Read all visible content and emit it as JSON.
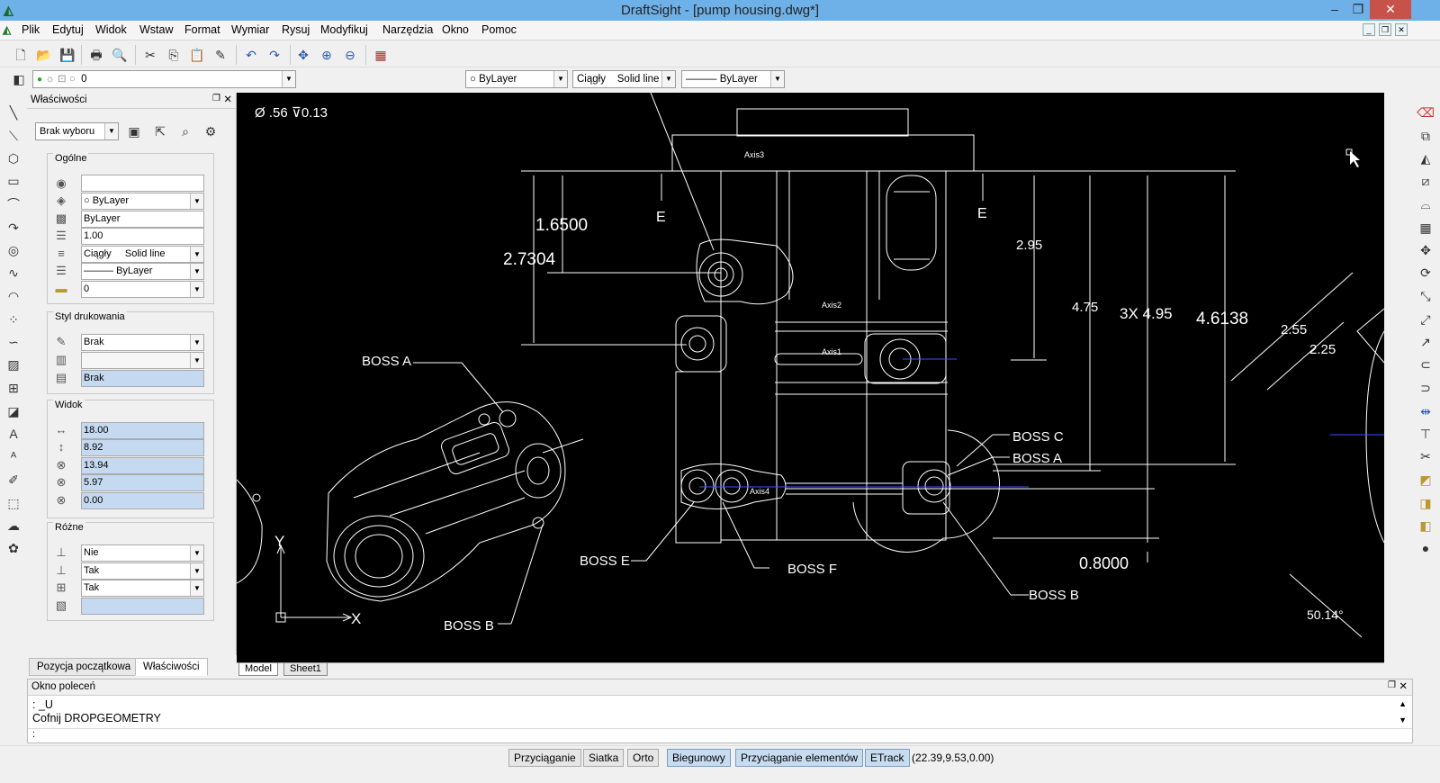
{
  "app": {
    "title": "DraftSight - [pump housing.dwg*]"
  },
  "menu": [
    "Plik",
    "Edytuj",
    "Widok",
    "Wstaw",
    "Format",
    "Wymiar",
    "Rysuj",
    "Modyfikuj",
    "Narzędzia",
    "Okno",
    "Pomoc"
  ],
  "layer_toolbar": {
    "layer": "0",
    "color": "ByLayer",
    "linetype": "Ciągły",
    "linetype_desc": "Solid line",
    "lineweight": "ByLayer"
  },
  "properties": {
    "panel_title": "Właściwości",
    "selection": "Brak wyboru",
    "general": {
      "title": "Ogólne",
      "color": "ByLayer",
      "linetype_scale_label": "ByLayer",
      "scale": "1.00",
      "linetype": "Ciągły",
      "linetype_desc": "Solid line",
      "lineweight": "ByLayer",
      "layer": "0"
    },
    "print_style": {
      "title": "Styl drukowania",
      "style": "Brak",
      "table": "Brak"
    },
    "view": {
      "title": "Widok",
      "width": "18.00",
      "height": "8.92",
      "center_x": "13.94",
      "center_y": "5.97",
      "center_z": "0.00"
    },
    "misc": {
      "title": "Różne",
      "ucs_icon_on": "Nie",
      "ucs_icon_origin": "Tak",
      "ucs_per_viewport": "Tak"
    }
  },
  "panel_tabs": [
    "Pozycja początkowa",
    "Właściwości"
  ],
  "sheet_tabs": [
    "Model",
    "Sheet1"
  ],
  "command_window": {
    "title": "Okno poleceń",
    "lines": [
      ": _U",
      "Cofnij DROPGEOMETRY"
    ],
    "prompt": ":"
  },
  "status": {
    "buttons": [
      "Przyciąganie",
      "Siatka",
      "Orto",
      "Biegunowy",
      "Przyciąganie elementów",
      "ETrack"
    ],
    "active": [
      "Biegunowy",
      "Przyciąganie elementów",
      "ETrack"
    ],
    "coords": "(22.39,9.53,0.00)"
  },
  "drawing": {
    "annotations": {
      "top_left_text": "Ø .56 ⊽0.13",
      "dim_1": "1.6500",
      "dim_2": "2.7304",
      "dim_3": "2.95",
      "dim_4": "4.75",
      "dim_5": "3X 4.95",
      "dim_6": "4.6138",
      "dim_7": "2.55",
      "dim_8": "2.25",
      "dim_9": "0.8000",
      "dim_10": "50.14°",
      "label_boss_a1": "BOSS A",
      "label_boss_a2": "BOSS A",
      "label_boss_b1": "BOSS B",
      "label_boss_b2": "BOSS B",
      "label_boss_c": "BOSS C",
      "label_boss_e": "BOSS E",
      "label_boss_f": "BOSS F",
      "section_e1": "E",
      "section_e2": "E",
      "axis1": "Axis1",
      "axis2": "Axis2",
      "axis3": "Axis3",
      "axis4": "Axis4",
      "ucs_x": "X",
      "ucs_y": "Y"
    }
  },
  "colors": {
    "canvas": "#000000",
    "lines": "#ffffff",
    "titlebar": "#6eb1e8",
    "active_status": "#c8dcf0"
  }
}
